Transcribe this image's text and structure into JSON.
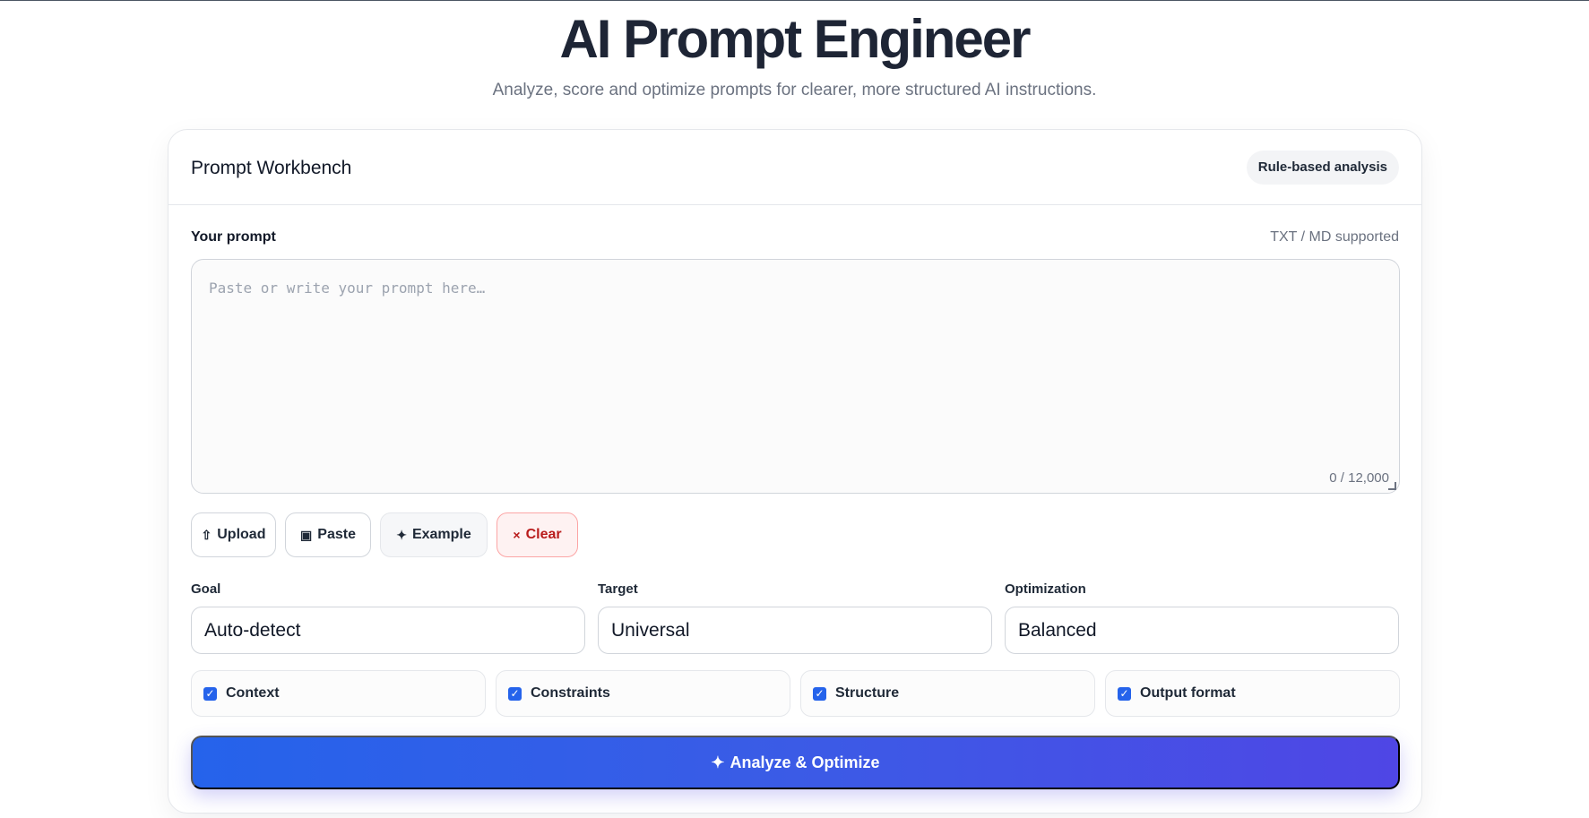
{
  "header": {
    "title": "AI Prompt Engineer",
    "subtitle": "Analyze, score and optimize prompts for clearer, more structured AI instructions."
  },
  "card": {
    "title": "Prompt Workbench",
    "badge": "Rule-based analysis"
  },
  "prompt": {
    "label": "Your prompt",
    "hint": "TXT / MD supported",
    "value": "",
    "placeholder": "Paste or write your prompt here…",
    "char_count": "0 / 12,000"
  },
  "actions": [
    {
      "icon": "upload-icon",
      "glyph": "⇧",
      "label": "Upload"
    },
    {
      "icon": "clipboard-icon",
      "glyph": "▣",
      "label": "Paste"
    },
    {
      "icon": "sparkle-icon",
      "glyph": "✦",
      "label": "Example"
    },
    {
      "icon": "close-icon",
      "glyph": "×",
      "label": "Clear"
    }
  ],
  "selects": [
    {
      "label": "Goal",
      "value": "Auto-detect"
    },
    {
      "label": "Target",
      "value": "Universal"
    },
    {
      "label": "Optimization",
      "value": "Balanced"
    }
  ],
  "options": [
    {
      "label": "Context",
      "checked": true
    },
    {
      "label": "Constraints",
      "checked": true
    },
    {
      "label": "Structure",
      "checked": true
    },
    {
      "label": "Output format",
      "checked": true
    }
  ],
  "submit": {
    "glyph": "✦",
    "label": "Analyze & Optimize"
  },
  "colors": {
    "accent": "#2563eb",
    "accent_end": "#4f46e5",
    "danger": "#b91c1c"
  }
}
